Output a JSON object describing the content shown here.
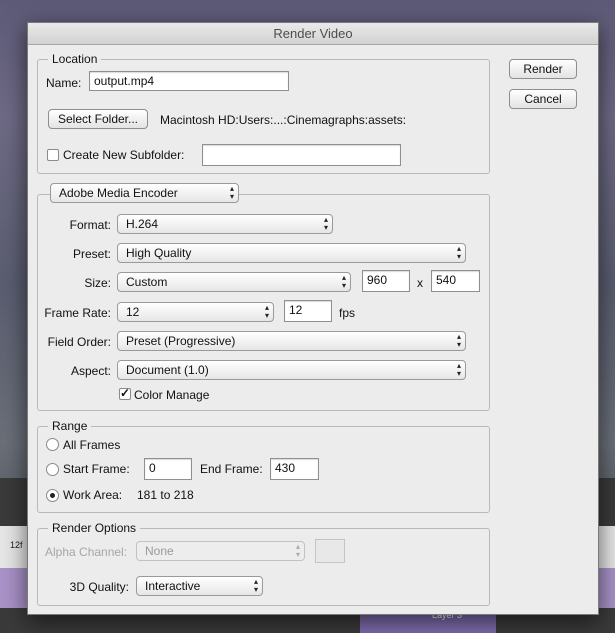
{
  "window": {
    "title": "Render Video"
  },
  "background": {
    "ruler_tick": "12f",
    "layer_label": "Layer 3"
  },
  "buttons": {
    "render": "Render",
    "cancel": "Cancel"
  },
  "location": {
    "legend": "Location",
    "name_label": "Name:",
    "name_value": "output.mp4",
    "select_folder": "Select Folder...",
    "folder_path": "Macintosh HD:Users:...:Cinemagraphs:assets:",
    "subfolder_label": "Create New Subfolder:",
    "subfolder_checked": false,
    "subfolder_value": ""
  },
  "encoder": {
    "selected": "Adobe Media Encoder",
    "format_label": "Format:",
    "format": "H.264",
    "preset_label": "Preset:",
    "preset": "High Quality",
    "size_label": "Size:",
    "size": "Custom",
    "width": "960",
    "height": "540",
    "size_sep": "x",
    "frame_rate_label": "Frame Rate:",
    "frame_rate": "12",
    "fps_value": "12",
    "fps_unit": "fps",
    "field_order_label": "Field Order:",
    "field_order": "Preset (Progressive)",
    "aspect_label": "Aspect:",
    "aspect": "Document (1.0)",
    "color_manage_label": "Color Manage",
    "color_manage_checked": true
  },
  "range": {
    "legend": "Range",
    "all_frames_label": "All Frames",
    "start_frame_label": "Start Frame:",
    "start_frame": "0",
    "end_frame_label": "End Frame:",
    "end_frame": "430",
    "work_area_label": "Work Area:",
    "work_area": "181 to 218",
    "selected": "work_area"
  },
  "render_options": {
    "legend": "Render Options",
    "alpha_channel_label": "Alpha Channel:",
    "alpha_channel": "None",
    "quality_label": "3D Quality:",
    "quality": "Interactive"
  }
}
